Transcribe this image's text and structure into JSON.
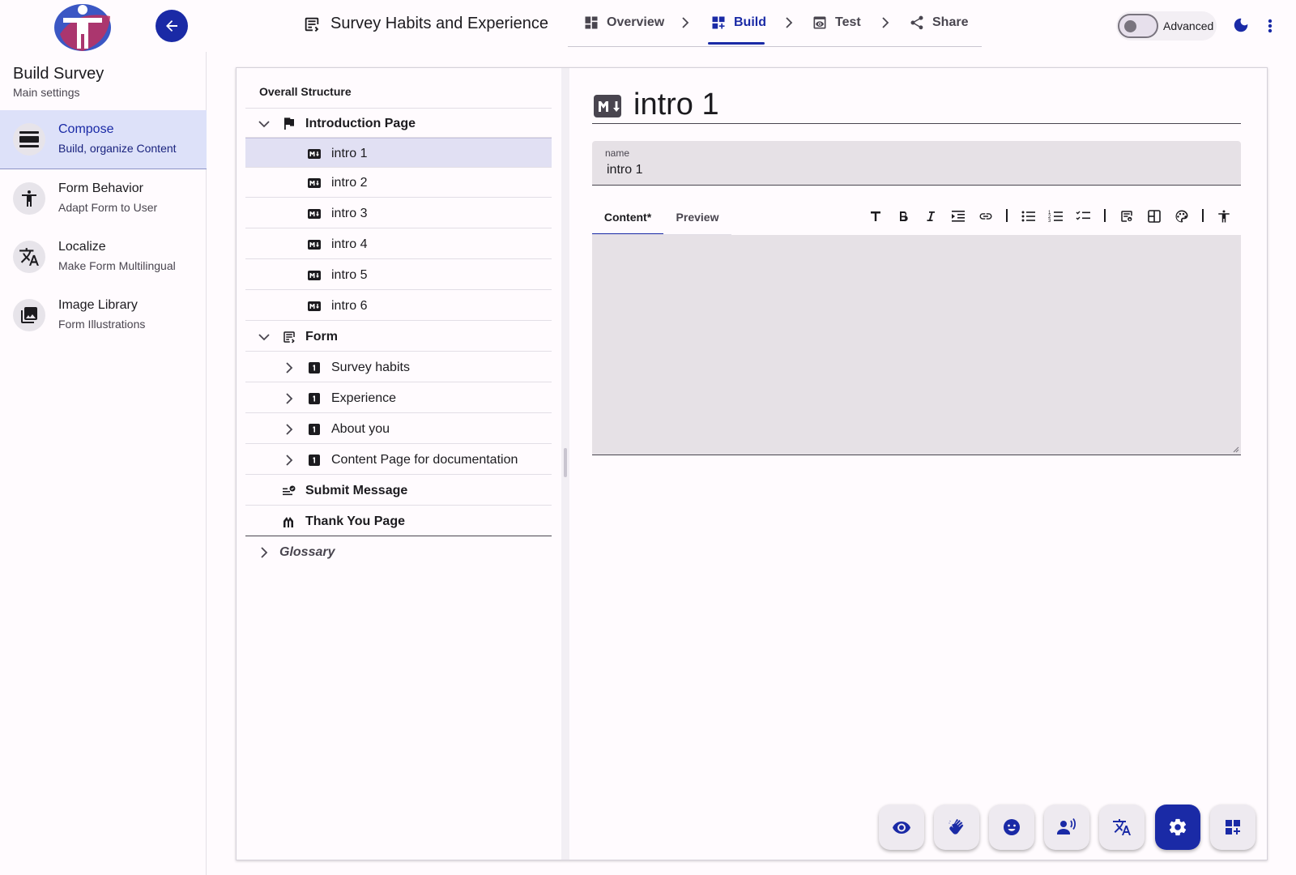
{
  "header": {
    "survey_title": "Survey Habits and Experience",
    "steps": [
      {
        "label": "Overview"
      },
      {
        "label": "Build"
      },
      {
        "label": "Test"
      },
      {
        "label": "Share"
      }
    ],
    "advanced_label": "Advanced",
    "advanced_on": false
  },
  "sidebar": {
    "title": "Build Survey",
    "subtitle": "Main settings",
    "items": [
      {
        "label": "Compose",
        "desc": "Build, organize Content",
        "icon": "compose-icon",
        "active": true
      },
      {
        "label": "Form Behavior",
        "desc": "Adapt Form to User",
        "icon": "accessibility-icon"
      },
      {
        "label": "Localize",
        "desc": "Make Form Multilingual",
        "icon": "translate-icon"
      },
      {
        "label": "Image Library",
        "desc": "Form Illustrations",
        "icon": "image-icon"
      }
    ]
  },
  "tree": {
    "title": "Overall Structure",
    "intro_page": "Introduction Page",
    "intros": [
      "intro 1",
      "intro 2",
      "intro 3",
      "intro 4",
      "intro 5",
      "intro 6"
    ],
    "form": "Form",
    "form_items": [
      "Survey habits",
      "Experience",
      "About you",
      "Content Page for documentation"
    ],
    "submit": "Submit Message",
    "thank_you": "Thank You Page",
    "glossary": "Glossary"
  },
  "editor": {
    "title": "intro 1",
    "name_label": "name",
    "name_value": "intro 1",
    "tabs": [
      "Content*",
      "Preview"
    ],
    "content_value": ""
  },
  "colors": {
    "accent": "#1a2aa6",
    "selected_row": "#e1e0f3",
    "field_bg": "#e6e1e6"
  },
  "fabs": [
    "eye-icon",
    "sign-language-icon",
    "smile-icon",
    "voice-icon",
    "translate-icon",
    "settings-icon",
    "add-widget-icon"
  ]
}
